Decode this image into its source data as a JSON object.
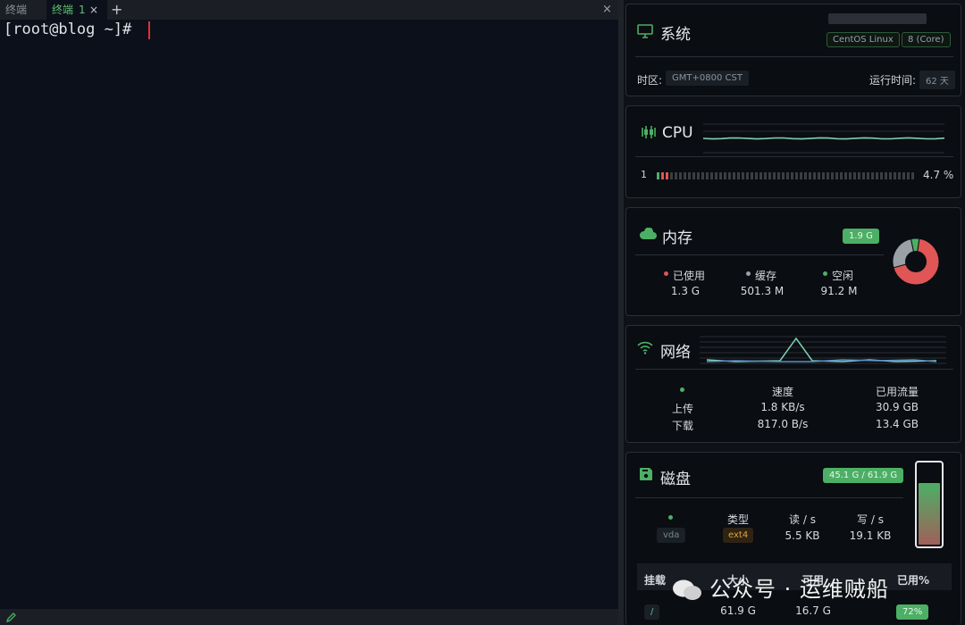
{
  "terminal": {
    "tabs": [
      {
        "label": "终端"
      },
      {
        "label": "终端",
        "number": "1"
      }
    ],
    "add_tab_label": "+",
    "close_label": "×",
    "prompt": "[root@blog ~]#"
  },
  "system": {
    "title": "系统",
    "os": "CentOS Linux",
    "cores": "8 (Core)",
    "timezone_label": "时区:",
    "timezone": "GMT+0800  CST",
    "uptime_label": "运行时间:",
    "uptime": "62 天"
  },
  "cpu": {
    "title": "CPU",
    "core_index": "1",
    "usage": "4.7 %",
    "history_level": 0.08
  },
  "memory": {
    "title": "内存",
    "total": "1.9 G",
    "items": [
      {
        "label": "已使用",
        "value": "1.3 G",
        "color": "#e05555"
      },
      {
        "label": "缓存",
        "value": "501.3 M",
        "color": "#9aa0a6"
      },
      {
        "label": "空闲",
        "value": "91.2 M",
        "color": "#4caf65"
      }
    ],
    "donut_fractions": [
      0.684,
      0.258,
      0.058
    ]
  },
  "network": {
    "title": "网络",
    "headers": [
      "速度",
      "已用流量"
    ],
    "rows": [
      {
        "label": "上传",
        "speed": "1.8 KB/s",
        "total": "30.9 GB"
      },
      {
        "label": "下载",
        "speed": "817.0 B/s",
        "total": "13.4 GB"
      }
    ]
  },
  "disk": {
    "title": "磁盘",
    "summary": "45.1 G / 61.9 G",
    "headers": [
      "类型",
      "读 / s",
      "写 / s"
    ],
    "device": "vda",
    "type": "ext4",
    "read": "5.5 KB",
    "write": "19.1 KB",
    "usage_fraction": 0.73,
    "table_headers": [
      "挂载",
      "大小",
      "可用",
      "已用%"
    ],
    "table_rows": [
      {
        "mount": "/",
        "size": "61.9 G",
        "avail": "16.7 G",
        "used": "72%"
      }
    ]
  },
  "watermark": "公众号 · 运维贼船"
}
